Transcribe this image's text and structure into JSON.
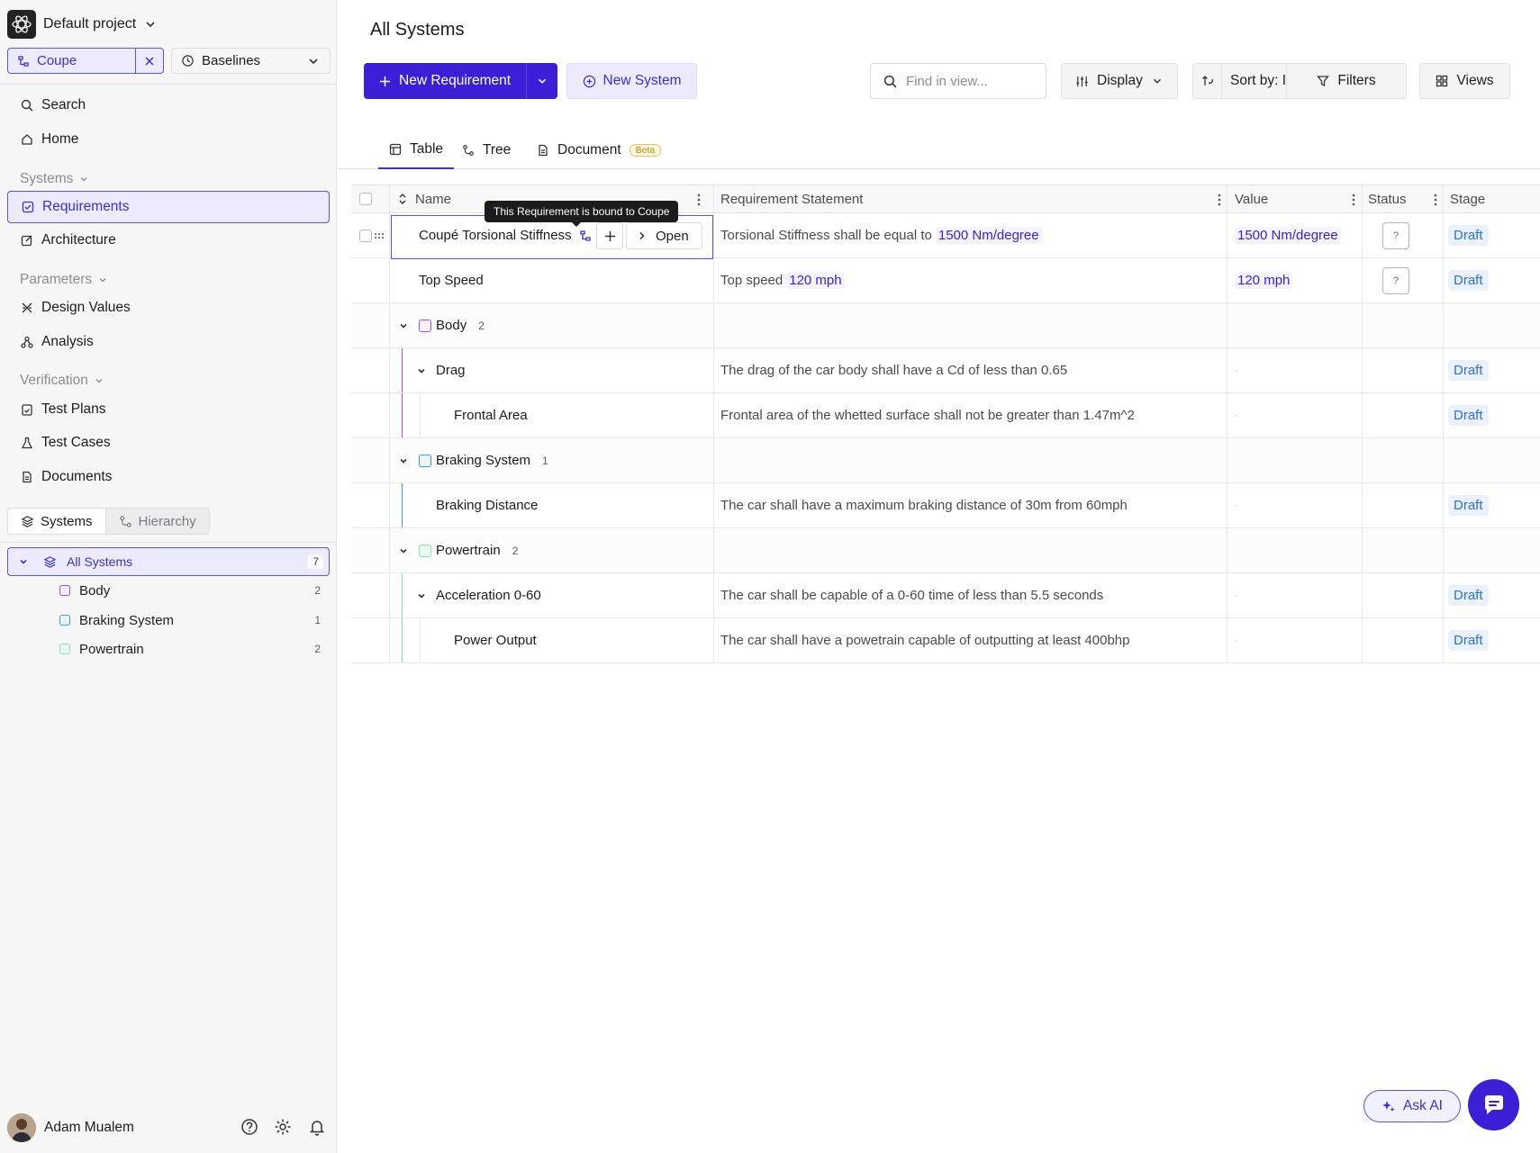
{
  "project": {
    "name": "Default project"
  },
  "system_filter": {
    "label": "Coupe",
    "baselines_label": "Baselines"
  },
  "nav": {
    "search": "Search",
    "home": "Home",
    "systems_section": "Systems",
    "requirements": "Requirements",
    "architecture": "Architecture",
    "parameters_section": "Parameters",
    "design_values": "Design Values",
    "analysis": "Analysis",
    "verification_section": "Verification",
    "test_plans": "Test Plans",
    "test_cases": "Test Cases",
    "documents": "Documents"
  },
  "sidebar_tabs": {
    "systems": "Systems",
    "hierarchy": "Hierarchy"
  },
  "system_tree": {
    "root": {
      "label": "All Systems",
      "count": "7"
    },
    "items": [
      {
        "label": "Body",
        "count": "2",
        "color": "#a855c8"
      },
      {
        "label": "Braking System",
        "count": "1",
        "color": "#3b9fd6"
      },
      {
        "label": "Powertrain",
        "count": "2",
        "color": "#5bc88a"
      }
    ]
  },
  "user": {
    "name": "Adam Mualem"
  },
  "header": {
    "title": "All Systems",
    "new_requirement": "New Requirement",
    "new_system": "New System",
    "search_placeholder": "Find in view...",
    "display": "Display",
    "sort": "Sort by: ID",
    "filters": "Filters",
    "views": "Views"
  },
  "view_tabs": {
    "table": "Table",
    "tree": "Tree",
    "document": "Document",
    "beta": "Beta"
  },
  "table": {
    "columns": {
      "name": "Name",
      "statement": "Requirement Statement",
      "value": "Value",
      "status": "Status",
      "stage": "Stage"
    },
    "tooltip": "This Requirement is bound to Coupe",
    "open_label": "Open",
    "status_unknown": "?",
    "rows": [
      {
        "name": "Coupé Torsional Stiffness",
        "statement": "Torsional Stiffness shall be equal to",
        "statement_value": "1500 Nm/degree",
        "value": "1500 Nm/degree",
        "stage": "Draft"
      },
      {
        "name": "Top Speed",
        "statement": "Top speed",
        "statement_value": "120 mph",
        "value": "120 mph",
        "stage": "Draft"
      },
      {
        "group": "Body",
        "count": "2"
      },
      {
        "name": "Drag",
        "statement": "The drag of the car body shall have a Cd of less than 0.65",
        "stage": "Draft"
      },
      {
        "name": "Frontal Area",
        "statement": "Frontal area of the whetted surface shall not be greater than 1.47m^2",
        "stage": "Draft"
      },
      {
        "group": "Braking System",
        "count": "1"
      },
      {
        "name": "Braking Distance",
        "statement": "The car shall have a maximum braking distance of 30m from 60mph",
        "stage": "Draft"
      },
      {
        "group": "Powertrain",
        "count": "2"
      },
      {
        "name": "Acceleration 0-60",
        "statement": "The car shall be capable of a 0-60 time of less than 5.5 seconds",
        "stage": "Draft"
      },
      {
        "name": "Power Output",
        "statement": "The car shall have a powetrain capable of outputting at least 400bhp",
        "stage": "Draft"
      }
    ]
  },
  "ask_ai": "Ask AI"
}
